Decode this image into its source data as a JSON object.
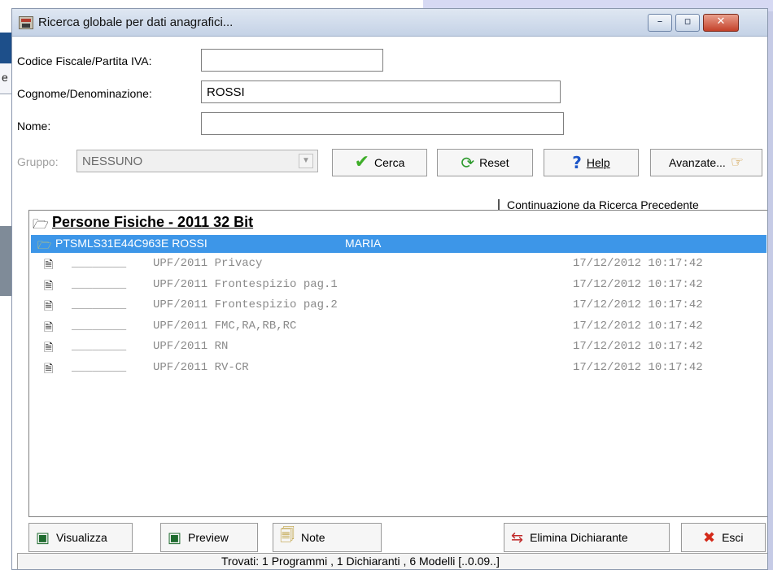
{
  "window": {
    "title": "Ricerca globale per dati anagrafici...",
    "controls": {
      "minimize": "–",
      "maximize": "▫",
      "close": "✕"
    }
  },
  "background": {
    "left_text": "e"
  },
  "form": {
    "codice_label": "Codice Fiscale/Partita IVA:",
    "codice_value": "",
    "cognome_label": "Cognome/Denominazione:",
    "cognome_value": "ROSSI",
    "nome_label": "Nome:",
    "nome_value": "",
    "gruppo_label": "Gruppo:",
    "gruppo_value": "NESSUNO"
  },
  "toolbar": {
    "cerca_label": "Cerca",
    "reset_label": "Reset",
    "help_label": "Help",
    "avanzate_label": "Avanzate...",
    "continuazione_label": "Continuazione da Ricerca Precedente"
  },
  "results": {
    "group_title": "Persone Fisiche - 2011 32 Bit",
    "selected": {
      "code": "PTSMLS31E44C963E ROSSI",
      "first_name": "MARIA"
    },
    "models": [
      {
        "blank": "________",
        "name": "UPF/2011 Privacy",
        "timestamp": "17/12/2012 10:17:42"
      },
      {
        "blank": "________",
        "name": "UPF/2011 Frontespizio pag.1",
        "timestamp": "17/12/2012 10:17:42"
      },
      {
        "blank": "________",
        "name": "UPF/2011 Frontespizio pag.2",
        "timestamp": "17/12/2012 10:17:42"
      },
      {
        "blank": "________",
        "name": "UPF/2011 FMC,RA,RB,RC",
        "timestamp": "17/12/2012 10:17:42"
      },
      {
        "blank": "________",
        "name": "UPF/2011 RN",
        "timestamp": "17/12/2012 10:17:42"
      },
      {
        "blank": "________",
        "name": "UPF/2011 RV-CR",
        "timestamp": "17/12/2012 10:17:42"
      }
    ]
  },
  "bottom": {
    "visualizza_label": "Visualizza",
    "preview_label": "Preview",
    "note_label": "Note",
    "elimina_label": "Elimina Dichiarante",
    "esci_label": "Esci"
  },
  "status": {
    "text": "Trovati: 1 Programmi , 1 Dichiaranti , 6 Modelli [..0.09..]"
  },
  "colors": {
    "selection": "#3d96e8",
    "titlebar": "#c4d2e6",
    "cerca_check": "#3fae2a",
    "esci_x": "#d42a1a"
  },
  "icons": {
    "cerca": "checkmark-icon",
    "reset": "refresh-icon",
    "help": "question-icon",
    "avanzate": "pointing-hand-icon",
    "group": "folder-open-icon",
    "document": "document-icon",
    "visualizza": "monitor-icon",
    "preview": "monitor-icon",
    "note": "notepad-icon",
    "elimina": "swap-arrows-icon",
    "esci": "x-icon"
  }
}
